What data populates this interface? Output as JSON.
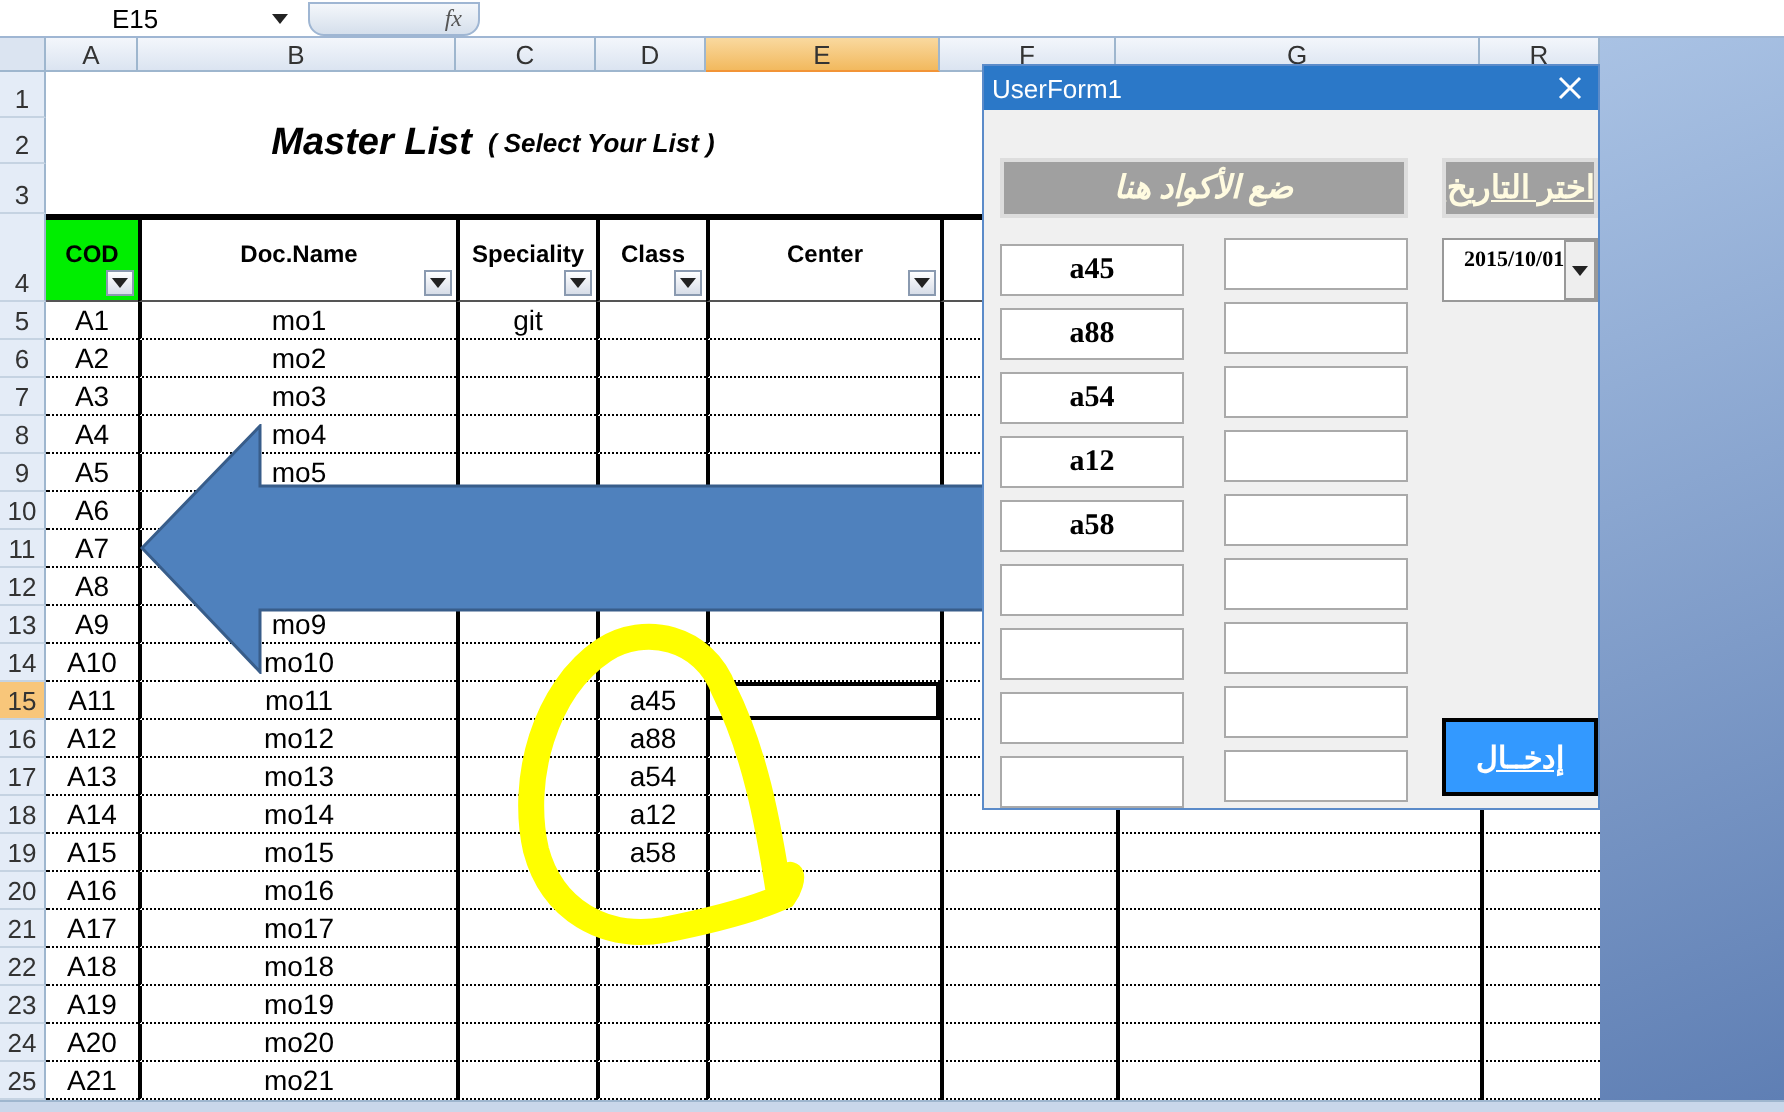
{
  "formula_bar": {
    "name_box": "E15",
    "function_label": "fx"
  },
  "columns": [
    {
      "letter": "A",
      "selected": false
    },
    {
      "letter": "B",
      "selected": false
    },
    {
      "letter": "C",
      "selected": false
    },
    {
      "letter": "D",
      "selected": false
    },
    {
      "letter": "E",
      "selected": true
    },
    {
      "letter": "F",
      "selected": false
    },
    {
      "letter": "G",
      "selected": false
    },
    {
      "letter": "R",
      "selected": false
    }
  ],
  "title": {
    "row_numbers": [
      "1",
      "2",
      "3"
    ],
    "main": "Master List",
    "sub": "( Select Your List )"
  },
  "header_row": {
    "number": "4",
    "cells": [
      {
        "label": "COD",
        "highlighted": true
      },
      {
        "label": "Doc.Name",
        "highlighted": false
      },
      {
        "label": "Speciality",
        "highlighted": false
      },
      {
        "label": "Class",
        "highlighted": false
      },
      {
        "label": "Center",
        "highlighted": false
      }
    ]
  },
  "rows": [
    {
      "number": "5",
      "selected": false,
      "cod": "A1",
      "doc_name": "mo1",
      "speciality": "git"
    },
    {
      "number": "6",
      "selected": false,
      "cod": "A2",
      "doc_name": "mo2"
    },
    {
      "number": "7",
      "selected": false,
      "cod": "A3",
      "doc_name": "mo3"
    },
    {
      "number": "8",
      "selected": false,
      "cod": "A4",
      "doc_name": "mo4"
    },
    {
      "number": "9",
      "selected": false,
      "cod": "A5",
      "doc_name": "mo5"
    },
    {
      "number": "10",
      "selected": false,
      "cod": "A6"
    },
    {
      "number": "11",
      "selected": false,
      "cod": "A7"
    },
    {
      "number": "12",
      "selected": false,
      "cod": "A8"
    },
    {
      "number": "13",
      "selected": false,
      "cod": "A9",
      "doc_name": "mo9"
    },
    {
      "number": "14",
      "selected": false,
      "cod": "A10",
      "doc_name": "mo10"
    },
    {
      "number": "15",
      "selected": true,
      "cod": "A11",
      "doc_name": "mo11",
      "class": "a45"
    },
    {
      "number": "16",
      "selected": false,
      "cod": "A12",
      "doc_name": "mo12",
      "class": "a88"
    },
    {
      "number": "17",
      "selected": false,
      "cod": "A13",
      "doc_name": "mo13",
      "class": "a54"
    },
    {
      "number": "18",
      "selected": false,
      "cod": "A14",
      "doc_name": "mo14",
      "class": "a12"
    },
    {
      "number": "19",
      "selected": false,
      "cod": "A15",
      "doc_name": "mo15",
      "class": "a58"
    },
    {
      "number": "20",
      "selected": false,
      "cod": "A16",
      "doc_name": "mo16"
    },
    {
      "number": "21",
      "selected": false,
      "cod": "A17",
      "doc_name": "mo17"
    },
    {
      "number": "22",
      "selected": false,
      "cod": "A18",
      "doc_name": "mo18"
    },
    {
      "number": "23",
      "selected": false,
      "cod": "A19",
      "doc_name": "mo19"
    },
    {
      "number": "24",
      "selected": false,
      "cod": "A20",
      "doc_name": "mo20"
    },
    {
      "number": "25",
      "selected": false,
      "cod": "A21",
      "doc_name": "mo21"
    }
  ],
  "dialog": {
    "title": "UserForm1",
    "codes_label": "ضع الأكواد هنا",
    "date_label": "اختر التاريخ",
    "date_value": "2015/10/01",
    "submit": "إدخــال",
    "left_fields": [
      {
        "kind": "filled",
        "value": "a45"
      },
      {
        "kind": "filled",
        "value": "a88"
      },
      {
        "kind": "filled",
        "value": "a54"
      },
      {
        "kind": "filled",
        "value": "a12"
      },
      {
        "kind": "filled",
        "value": "a58"
      },
      {
        "kind": "empty"
      },
      {
        "kind": "empty"
      },
      {
        "kind": "empty"
      },
      {
        "kind": "empty"
      }
    ],
    "right_fields": [
      {
        "kind": "empty"
      },
      {
        "kind": "empty"
      },
      {
        "kind": "empty"
      },
      {
        "kind": "empty"
      },
      {
        "kind": "empty"
      },
      {
        "kind": "empty"
      },
      {
        "kind": "empty"
      },
      {
        "kind": "empty"
      },
      {
        "kind": "empty"
      }
    ]
  }
}
